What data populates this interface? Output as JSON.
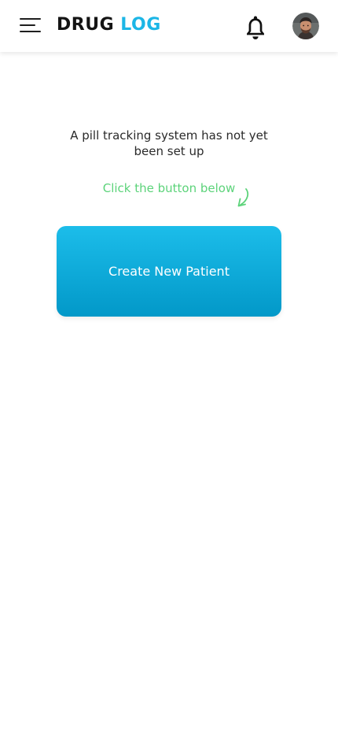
{
  "header": {
    "brand_part1": "DRUG",
    "brand_part2": "LOG",
    "menu_icon": "hamburger-menu-icon",
    "notification_icon": "bell-icon",
    "avatar_icon": "user-avatar"
  },
  "main": {
    "empty_message": "A pill tracking system has not yet been set up",
    "hint": "Click the button below",
    "hint_icon": "curved-arrow-down-icon",
    "create_button_label": "Create New Patient"
  },
  "colors": {
    "brand_dark": "#141414",
    "brand_accent": "#1cb6e6",
    "hint_green": "#5cd37a",
    "button_gradient_top": "#1cbdea",
    "button_gradient_bottom": "#0298c8"
  }
}
